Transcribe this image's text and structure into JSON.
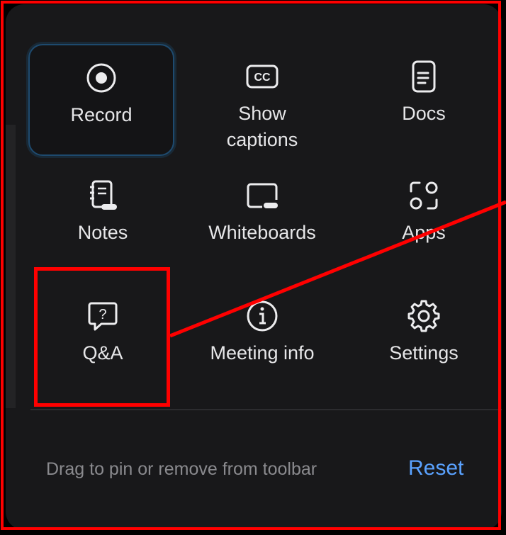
{
  "tools": [
    {
      "label": "Record",
      "icon": "record-icon"
    },
    {
      "label": "Show captions",
      "icon": "closed-captions-icon"
    },
    {
      "label": "Docs",
      "icon": "document-icon"
    },
    {
      "label": "Notes",
      "icon": "notes-icon"
    },
    {
      "label": "Whiteboards",
      "icon": "whiteboard-icon"
    },
    {
      "label": "Apps",
      "icon": "apps-icon"
    },
    {
      "label": "Q&A",
      "icon": "qa-icon"
    },
    {
      "label": "Meeting info",
      "icon": "info-icon"
    },
    {
      "label": "Settings",
      "icon": "gear-icon"
    }
  ],
  "captions_icon_text": "CC",
  "footer": {
    "hint": "Drag to pin or remove from toolbar",
    "reset_label": "Reset"
  },
  "colors": {
    "panel_bg": "#18181a",
    "text": "#e6e6e8",
    "accent": "#5aa2ff",
    "selected_border": "#1e4a6e",
    "annotation": "#ff0000"
  }
}
